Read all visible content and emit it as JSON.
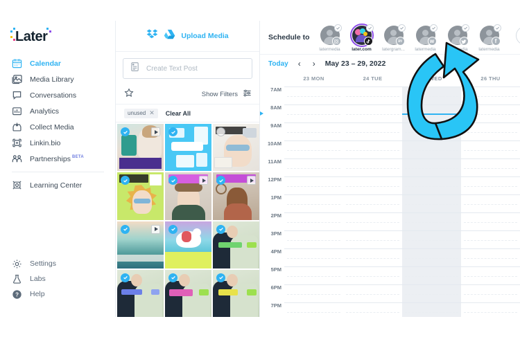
{
  "brand": {
    "logo_text": "Later",
    "accent": "#2fb3f2",
    "arrow_color": "#29c5f6",
    "selected_ring": "#8d4de8"
  },
  "sidebar": {
    "items": [
      {
        "label": "Calendar",
        "icon": "calendar-icon",
        "active": true
      },
      {
        "label": "Media Library",
        "icon": "image-icon",
        "active": false
      },
      {
        "label": "Conversations",
        "icon": "chat-bubble-icon",
        "active": false
      },
      {
        "label": "Analytics",
        "icon": "bar-chart-icon",
        "active": false
      },
      {
        "label": "Collect Media",
        "icon": "inbox-download-icon",
        "active": false
      },
      {
        "label": "Linkin.bio",
        "icon": "link-bio-icon",
        "active": false
      },
      {
        "label": "Partnerships",
        "icon": "people-icon",
        "active": false,
        "badge": "BETA"
      }
    ],
    "after_divider": [
      {
        "label": "Learning Center",
        "icon": "graduation-icon",
        "active": false
      }
    ],
    "bottom_items": [
      {
        "label": "Settings",
        "icon": "gear-icon"
      },
      {
        "label": "Labs",
        "icon": "flask-icon"
      },
      {
        "label": "Help",
        "icon": "question-circle-icon"
      }
    ]
  },
  "media_panel": {
    "upload_label": "Upload Media",
    "dropbox_icon": "dropbox-icon",
    "drive_icon": "google-drive-icon",
    "create_text_post_placeholder": "Create Text Post",
    "text_post_icon": "text-post-icon",
    "star_icon": "star-icon",
    "show_filters_label": "Show Filters",
    "filter_sliders_icon": "sliders-icon",
    "chip": {
      "label": "unused",
      "remove_icon": "close-icon"
    },
    "clear_all_label": "Clear All",
    "tiles": [
      {
        "selected": true,
        "video": true,
        "theme": "t1"
      },
      {
        "selected": true,
        "video": false,
        "theme": "t2"
      },
      {
        "selected": false,
        "video": false,
        "theme": "t3"
      },
      {
        "selected": false,
        "video": false,
        "theme": "t4"
      },
      {
        "selected": true,
        "video": true,
        "theme": "t5"
      },
      {
        "selected": true,
        "video": true,
        "theme": "t6"
      },
      {
        "selected": true,
        "video": true,
        "theme": "t7"
      },
      {
        "selected": true,
        "video": false,
        "theme": "t8"
      },
      {
        "selected": true,
        "video": false,
        "theme": "t9"
      },
      {
        "selected": true,
        "video": false,
        "theme": "t10"
      },
      {
        "selected": true,
        "video": false,
        "theme": "t11"
      },
      {
        "selected": true,
        "video": false,
        "theme": "t12"
      }
    ]
  },
  "calendar": {
    "schedule_to_label": "Schedule to",
    "accounts": [
      {
        "name": "latermedia",
        "platform": "instagram",
        "selected": false
      },
      {
        "name": "later.com",
        "platform": "tiktok",
        "selected": true
      },
      {
        "name": "latergram...",
        "platform": "linkedin",
        "selected": false
      },
      {
        "name": "latermedia",
        "platform": "pinterest",
        "selected": false
      },
      {
        "name": "latermedia",
        "platform": "twitter",
        "selected": false
      },
      {
        "name": "latermedia",
        "platform": "facebook",
        "selected": false
      }
    ],
    "add_account_label": "+",
    "today_label": "Today",
    "prev_label": "‹",
    "next_label": "›",
    "date_range": "May 23 – 29, 2022",
    "day_columns": [
      {
        "label": "23 MON",
        "today": false
      },
      {
        "label": "24 TUE",
        "today": false
      },
      {
        "label": "25 WED",
        "today": true
      },
      {
        "label": "26 THU",
        "today": false
      }
    ],
    "hours": [
      "7AM",
      "8AM",
      "9AM",
      "10AM",
      "11AM",
      "12PM",
      "1PM",
      "2PM",
      "3PM",
      "4PM",
      "5PM",
      "6PM",
      "7PM"
    ],
    "current_time_row": 1
  },
  "annotation": {
    "arrow_name": "callout-arrow",
    "points_to": "add-account-button"
  }
}
